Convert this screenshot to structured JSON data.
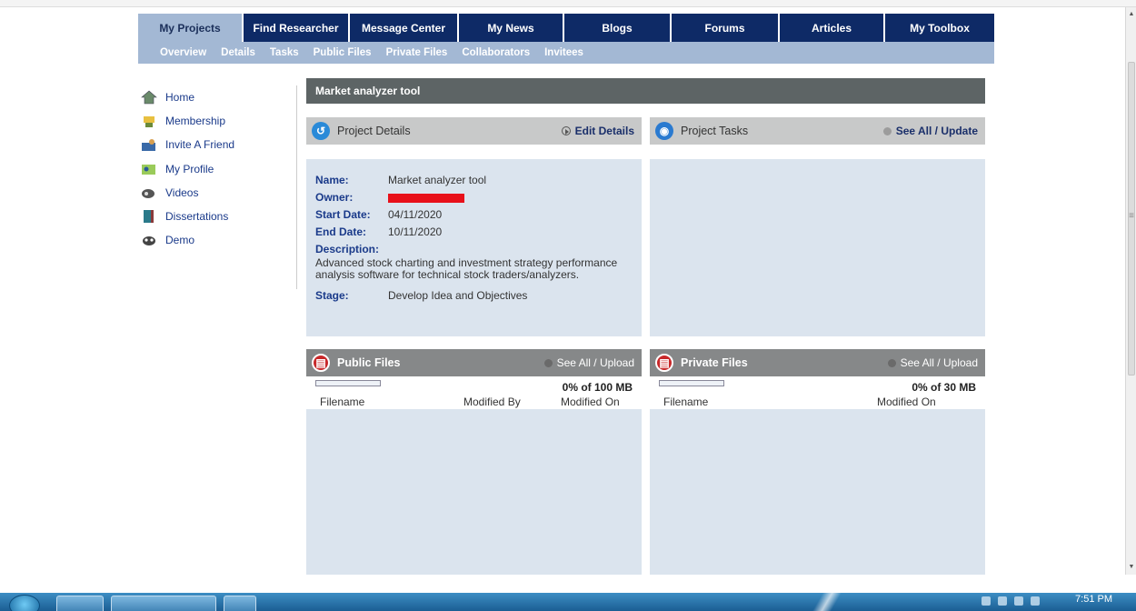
{
  "nav": {
    "tabs": [
      {
        "label": "My Projects",
        "active": true
      },
      {
        "label": "Find Researcher",
        "active": false
      },
      {
        "label": "Message Center",
        "active": false
      },
      {
        "label": "My News",
        "active": false
      },
      {
        "label": "Blogs",
        "active": false
      },
      {
        "label": "Forums",
        "active": false
      },
      {
        "label": "Articles",
        "active": false
      },
      {
        "label": "My Toolbox",
        "active": false
      }
    ],
    "subtabs": [
      "Overview",
      "Details",
      "Tasks",
      "Public Files",
      "Private Files",
      "Collaborators",
      "Invitees"
    ]
  },
  "sidebar": {
    "items": [
      {
        "label": "Home",
        "icon": "home-icon"
      },
      {
        "label": "Membership",
        "icon": "membership-icon"
      },
      {
        "label": "Invite A Friend",
        "icon": "invite-icon"
      },
      {
        "label": "My Profile",
        "icon": "profile-icon"
      },
      {
        "label": "Videos",
        "icon": "video-icon"
      },
      {
        "label": "Dissertations",
        "icon": "book-icon"
      },
      {
        "label": "Demo",
        "icon": "demo-icon"
      }
    ]
  },
  "page": {
    "title": "Market analyzer tool"
  },
  "details": {
    "heading": "Project Details",
    "action": "Edit Details",
    "name_label": "Name:",
    "name": "Market analyzer tool",
    "owner_label": "Owner:",
    "start_label": "Start Date:",
    "start": "04/11/2020",
    "end_label": "End Date:",
    "end": "10/11/2020",
    "desc_label": "Description:",
    "description": "Advanced stock charting and investment strategy performance analysis software for technical stock traders/analyzers.",
    "stage_label": "Stage:",
    "stage": "Develop Idea and Objectives"
  },
  "tasks": {
    "heading": "Project Tasks",
    "action": "See All / Update"
  },
  "public_files": {
    "heading": "Public Files",
    "action": "See All / Upload",
    "quota": "0% of 100 MB",
    "usage_fraction": 0,
    "columns": [
      "Filename",
      "Modified By",
      "Modified On"
    ]
  },
  "private_files": {
    "heading": "Private Files",
    "action": "See All / Upload",
    "quota": "0% of 30 MB",
    "usage_fraction": 0,
    "columns": [
      "Filename",
      "Modified On"
    ]
  },
  "taskbar": {
    "time": "7:51 PM"
  }
}
